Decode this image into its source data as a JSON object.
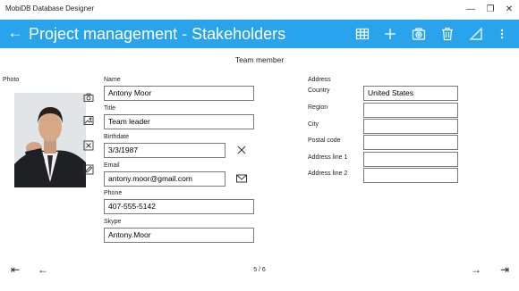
{
  "window": {
    "title": "MobiDB Database Designer",
    "minimize_glyph": "—",
    "maximize_glyph": "❐",
    "close_glyph": "✕"
  },
  "header": {
    "back_glyph": "←",
    "title": "Project management - Stakeholders",
    "background": "#29a3ec",
    "toolbar_icons": [
      "table-icon",
      "add-icon",
      "settings-icon",
      "delete-icon",
      "edit-icon",
      "more-icon"
    ]
  },
  "form": {
    "section_title": "Team member",
    "photo_label": "Photo",
    "photo_icons": [
      "camera-icon",
      "image-icon",
      "clear-photo-icon",
      "edit-photo-icon"
    ],
    "name": {
      "label": "Name",
      "value": "Antony Moor"
    },
    "title": {
      "label": "Title",
      "value": "Team leader"
    },
    "birthdate": {
      "label": "Birthdate",
      "value": "3/3/1987",
      "clear_icon": "clear-icon"
    },
    "email": {
      "label": "Email",
      "value": "antony.moor@gmail.com",
      "action_icon": "mail-icon"
    },
    "phone": {
      "label": "Phone",
      "value": "407-555-5142"
    },
    "skype": {
      "label": "Skype",
      "value": "Antony.Moor"
    },
    "address": {
      "label": "Address",
      "country": {
        "label": "Country",
        "value": "United States"
      },
      "region": {
        "label": "Region",
        "value": ""
      },
      "city": {
        "label": "City",
        "value": ""
      },
      "postal_code": {
        "label": "Postal code",
        "value": ""
      },
      "line1": {
        "label": "Address line 1",
        "value": ""
      },
      "line2": {
        "label": "Address line 2",
        "value": ""
      }
    }
  },
  "footer": {
    "first_glyph": "⇤",
    "prev_glyph": "←",
    "pager": "5 / 6",
    "next_glyph": "→",
    "last_glyph": "⇥"
  }
}
